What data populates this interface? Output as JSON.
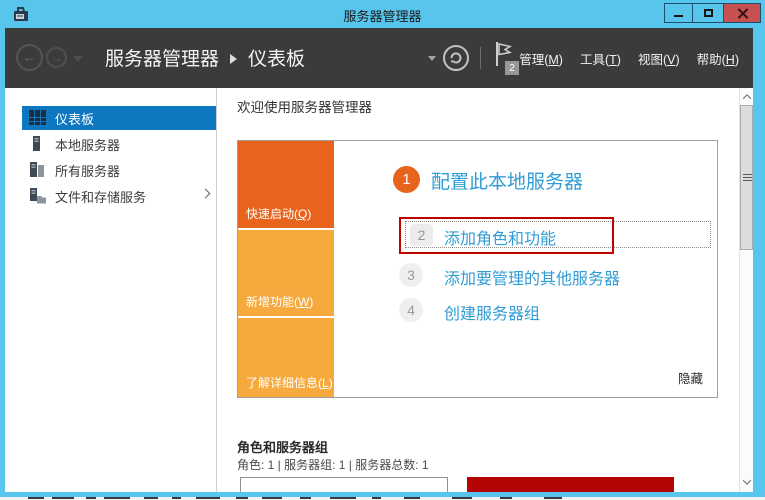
{
  "titlebar": {
    "title": "服务器管理器"
  },
  "navbar": {
    "breadcrumb_root": "服务器管理器",
    "breadcrumb_current": "仪表板",
    "badge_count": "2",
    "menus": [
      {
        "pre": "管理(",
        "key": "M",
        "post": ")"
      },
      {
        "pre": "工具(",
        "key": "T",
        "post": ")"
      },
      {
        "pre": "视图(",
        "key": "V",
        "post": ")"
      },
      {
        "pre": "帮助(",
        "key": "H",
        "post": ")"
      }
    ]
  },
  "sidebar": {
    "items": [
      {
        "label": "仪表板",
        "selected": true
      },
      {
        "label": "本地服务器",
        "selected": false
      },
      {
        "label": "所有服务器",
        "selected": false
      },
      {
        "label": "文件和存储服务",
        "selected": false
      }
    ]
  },
  "main": {
    "welcome_heading": "欢迎使用服务器管理器",
    "quick_panel": {
      "sections": [
        {
          "pre": "快速启动(",
          "key": "Q",
          "post": ")"
        },
        {
          "pre": "新增功能(",
          "key": "W",
          "post": ")"
        },
        {
          "pre": "了解详细信息(",
          "key": "L",
          "post": ")"
        }
      ],
      "steps": [
        {
          "num": "1",
          "label": "配置此本地服务器"
        },
        {
          "num": "2",
          "label": "添加角色和功能"
        },
        {
          "num": "3",
          "label": "添加要管理的其他服务器"
        },
        {
          "num": "4",
          "label": "创建服务器组"
        }
      ],
      "hide_label": "隐藏"
    },
    "roles_group": {
      "heading": "角色和服务器组",
      "stats": "角色: 1 | 服务器组: 1 | 服务器总数: 1"
    }
  },
  "colors": {
    "titlebar_blue": "#57c5ec",
    "navbar_dark": "#3b3b3b",
    "sidebar_selected_blue": "#0d77c0",
    "link_blue": "#2f9cd6",
    "quickstart_orange": "#e8641c",
    "panel_orange": "#f6a93c",
    "close_button_red": "#c75050",
    "alert_tile_red": "#b50404",
    "annotation_red": "#c10000"
  }
}
